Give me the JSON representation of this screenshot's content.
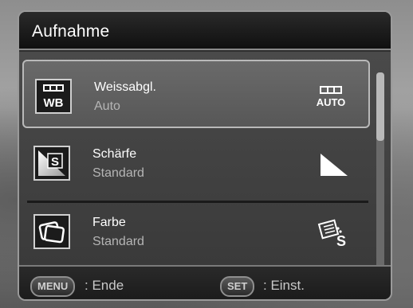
{
  "window": {
    "title": "Aufnahme"
  },
  "menu": {
    "items": [
      {
        "label": "Weissabgl.",
        "value": "Auto",
        "icon": "white-balance-icon",
        "value_icon": "wb-auto-icon",
        "value_icon_text": "AUTO",
        "selected": true
      },
      {
        "label": "Schärfe",
        "value": "Standard",
        "icon": "sharpness-icon",
        "value_icon": "sharpness-standard-triangle-icon",
        "selected": false
      },
      {
        "label": "Farbe",
        "value": "Standard",
        "icon": "color-icon",
        "value_icon": "color-standard-icon",
        "value_icon_text": "S",
        "selected": false
      }
    ]
  },
  "icon_text": {
    "wb": "WB",
    "sharp_s": "S"
  },
  "footer": {
    "menu_key": "MENU",
    "menu_action": ": Ende",
    "set_key": "SET",
    "set_action": ": Einst."
  },
  "colors": {
    "panel_bg": "#2f2f2f",
    "titlebar": "#101010",
    "selected_row": "#5f5f5f",
    "text_primary": "#ffffff",
    "text_secondary": "#b5b5b5"
  }
}
